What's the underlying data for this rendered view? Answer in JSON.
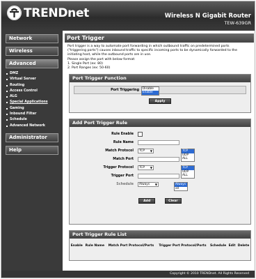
{
  "header": {
    "brand": "TRENDnet",
    "product_title": "Wireless N Gigabit Router",
    "model": "TEW-639GR"
  },
  "sidebar": {
    "network": "Network",
    "wireless": "Wireless",
    "advanced": "Advanced",
    "advanced_items": [
      "DMZ",
      "Virtual Server",
      "Routing",
      "Access Control",
      "ALG",
      "Special Applications",
      "Gaming",
      "Inbound Filter",
      "Schedule",
      "Advanced Network"
    ],
    "administrator": "Administrator",
    "help": "Help"
  },
  "page": {
    "title": "Port Trigger",
    "intro": [
      "Port trigger is a way to automate port forwarding in which outbound traffic on predetermined ports",
      "(\"triggering ports\") causes inbound traffic to specific incoming ports to be dynamically forwarded to the",
      "initiating host, while the outbound ports are in use.",
      "Please assign the port with below format:",
      "1. Single Port (ex: 80)",
      "2. Port Ranges (ex: 50-60)"
    ]
  },
  "trigger_function": {
    "title": "Port Trigger Function",
    "label": "Port Triggering",
    "options": [
      "Disable",
      "Enable"
    ],
    "selected": "Enable",
    "apply_label": "Apply"
  },
  "add_rule": {
    "title": "Add Port Trigger Rule",
    "rule_enable_label": "Rule Enable",
    "rule_name_label": "Rule Name",
    "rule_name_value": "",
    "match_protocol_label": "Match Protocol",
    "match_protocol_value": "TCP",
    "match_protocol_options": [
      "TCP",
      "UDP",
      "ALL"
    ],
    "match_port_label": "Match Port",
    "match_port_value": "",
    "trigger_protocol_label": "Trigger Protocol",
    "trigger_protocol_value": "TCP",
    "trigger_protocol_options": [
      "TCP",
      "UDP",
      "ALL"
    ],
    "trigger_port_label": "Trigger Port",
    "trigger_port_value": "",
    "schedule_label": "Schedule",
    "schedule_value": "Always",
    "schedule_options": [
      "Always",
      "all"
    ],
    "add_label": "Add",
    "clear_label": "Clear"
  },
  "rule_list": {
    "title": "Port Trigger Rule List",
    "columns": [
      "Enable",
      "Rule Name",
      "Match Port Protocol/Ports",
      "Trigger Port Protocol/Ports",
      "Schedule",
      "Edit",
      "Delete"
    ]
  },
  "footer": {
    "copyright": "Copyright © 2010 TRENDnet. All Rights Reserved"
  },
  "colors": {
    "header_bg": "#3a3a3a",
    "selection": "#2d6bd3"
  }
}
